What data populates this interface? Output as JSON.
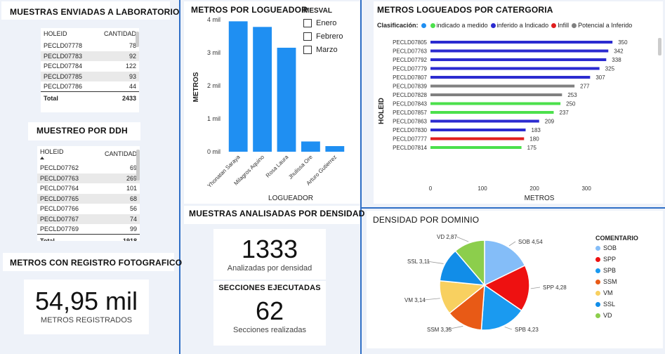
{
  "laboratorio": {
    "title": "MUESTRAS ENVIADAS A LABORATORIO",
    "headers": [
      "HOLEID",
      "CANTIDAD"
    ],
    "rows": [
      [
        "PECLD07778",
        "78"
      ],
      [
        "PECLD07783",
        "92"
      ],
      [
        "PECLD07784",
        "122"
      ],
      [
        "PECLD07785",
        "93"
      ],
      [
        "PECLD07786",
        "44"
      ]
    ],
    "total_label": "Total",
    "total_value": "2433"
  },
  "ddh": {
    "title": "MUESTREO POR DDH",
    "headers": [
      "HOLEID",
      "CANTIDAD"
    ],
    "sort_icon": "sort-asc-icon",
    "rows": [
      [
        "PECLD07762",
        "69"
      ],
      [
        "PECLD07763",
        "269"
      ],
      [
        "PECLD07764",
        "101"
      ],
      [
        "PECLD07765",
        "68"
      ],
      [
        "PECLD07766",
        "56"
      ],
      [
        "PECLD07767",
        "74"
      ],
      [
        "PECLD07769",
        "99"
      ]
    ],
    "total_label": "Total",
    "total_value": "1918"
  },
  "foto": {
    "title": "METROS CON REGISTRO FOTOGRAFICO",
    "value": "54,95 mil",
    "label": "METROS REGISTRADOS"
  },
  "densidad_kpi": {
    "title": "MUESTRAS ANALISADAS POR DENSIDAD",
    "value": "1333",
    "label": "Analizadas por densidad"
  },
  "secciones_kpi": {
    "title": "SECCIONES EJECUTADAS",
    "value": "62",
    "label": "Secciones realizadas"
  },
  "mesval": {
    "title": "MESVAL",
    "options": [
      "Enero",
      "Febrero",
      "Marzo"
    ]
  },
  "chart_data": [
    {
      "type": "bar",
      "title": "METROS POR LOGUEADOR",
      "xlabel": "LOGUEADOR",
      "ylabel": "METROS",
      "categories": [
        "Yhonatan Saraya",
        "Milagros Aquino",
        "Rosa Laura",
        "Jhulissa Ore",
        "Arturo Gutierrez"
      ],
      "values": [
        3950,
        3780,
        3150,
        310,
        170
      ],
      "yticks": [
        "0 mil",
        "1 mil",
        "2 mil",
        "3 mil",
        "4 mil"
      ],
      "ylim": [
        0,
        4000
      ],
      "color": "#1f8ff2"
    },
    {
      "type": "bar",
      "orientation": "horizontal",
      "title": "METROS LOGUEADOS POR CATERGORIA",
      "xlabel": "METROS",
      "ylabel": "HOLEID",
      "legend_title": "Clasificación:",
      "legend": [
        {
          "name": "",
          "color": "#1f8ff2"
        },
        {
          "name": "indicado a medido",
          "color": "#4ce04c"
        },
        {
          "name": "inferido a Indicado",
          "color": "#2b2bd0"
        },
        {
          "name": "Infill",
          "color": "#e01e1e"
        },
        {
          "name": "Potencial a Inferido",
          "color": "#808080"
        }
      ],
      "categories": [
        "PECLD07805",
        "PECLD07763",
        "PECLD07792",
        "PECLD07779",
        "PECLD07807",
        "PECLD07839",
        "PECLD07828",
        "PECLD07843",
        "PECLD07857",
        "PECLD07863",
        "PECLD07830",
        "PECLD07777",
        "PECLD07814"
      ],
      "values": [
        350,
        342,
        338,
        325,
        307,
        277,
        253,
        250,
        237,
        209,
        183,
        180,
        175
      ],
      "colors": [
        "#2b2bd0",
        "#2b2bd0",
        "#2b2bd0",
        "#2b2bd0",
        "#2b2bd0",
        "#808080",
        "#808080",
        "#4ce04c",
        "#4ce04c",
        "#2b2bd0",
        "#2b2bd0",
        "#e01e1e",
        "#4ce04c"
      ],
      "xticks": [
        "0",
        "100",
        "200",
        "300"
      ],
      "xlim": [
        0,
        370
      ]
    },
    {
      "type": "pie",
      "title": "DENSIDAD POR DOMINIO",
      "legend_title": "COMENTARIO",
      "slices": [
        {
          "name": "SOB",
          "label": "SOB 4,54",
          "value": 4.54,
          "color": "#84bdf8"
        },
        {
          "name": "SPP",
          "label": "SPP 4,28",
          "value": 4.28,
          "color": "#ee1111"
        },
        {
          "name": "SPB",
          "label": "SPB 4,23",
          "value": 4.23,
          "color": "#1a9af0"
        },
        {
          "name": "SSM",
          "label": "SSM 3,35",
          "value": 3.35,
          "color": "#e85a16"
        },
        {
          "name": "VM",
          "label": "VM 3,14",
          "value": 3.14,
          "color": "#f8d060"
        },
        {
          "name": "SSL",
          "label": "SSL 3,11",
          "value": 3.11,
          "color": "#118de8"
        },
        {
          "name": "VD",
          "label": "VD 2,87",
          "value": 2.87,
          "color": "#8cce4c"
        }
      ]
    }
  ]
}
